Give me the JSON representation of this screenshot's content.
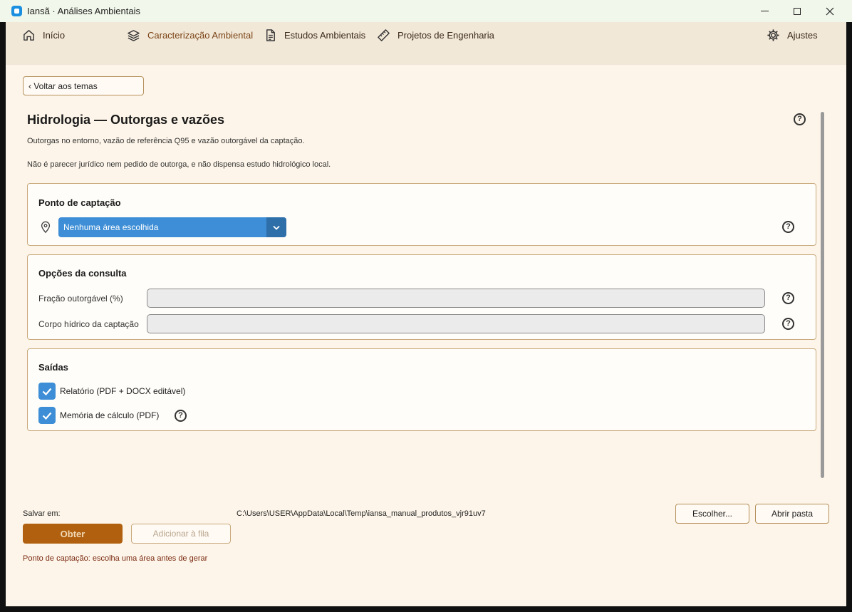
{
  "window": {
    "title": "Iansã · Análises Ambientais"
  },
  "nav": {
    "home": "Início",
    "caracterizacao": "Caracterização Ambiental",
    "estudos": "Estudos Ambientais",
    "projetos": "Projetos de Engenharia",
    "ajustes": "Ajustes"
  },
  "back_label": "‹ Voltar aos temas",
  "page": {
    "title": "Hidrologia — Outorgas e vazões",
    "subtitle1": "Outorgas no entorno, vazão de referência Q95 e vazão outorgável da captação.",
    "subtitle2": "Não é parecer jurídico nem pedido de outorga, e não dispensa estudo hidrológico local.",
    "help_glyph": "?"
  },
  "ponto": {
    "title": "Ponto de captação",
    "selected": "Nenhuma área escolhida"
  },
  "opcoes": {
    "title": "Opções da consulta",
    "fracao_label": "Fração outorgável (%)",
    "fracao_value": "",
    "corpo_label": "Corpo hídrico da captação",
    "corpo_value": ""
  },
  "saidas": {
    "title": "Saídas",
    "relatorio_label": "Relatório (PDF + DOCX editável)",
    "relatorio_checked": true,
    "memoria_label": "Memória de cálculo (PDF)",
    "memoria_checked": true
  },
  "footer": {
    "save_label": "Salvar em:",
    "save_path": "C:\\Users\\USER\\AppData\\Local\\Temp\\iansa_manual_produtos_vjr91uv7",
    "choose": "Escolher...",
    "open_folder": "Abrir pasta",
    "obtain": "Obter",
    "add_queue": "Adicionar à fila",
    "status": "Ponto de captação: escolha uma área antes de gerar"
  },
  "colors": {
    "accent_blue": "#3d8ed6",
    "primary_brown": "#b0600e",
    "background": "#fdf5e9"
  }
}
